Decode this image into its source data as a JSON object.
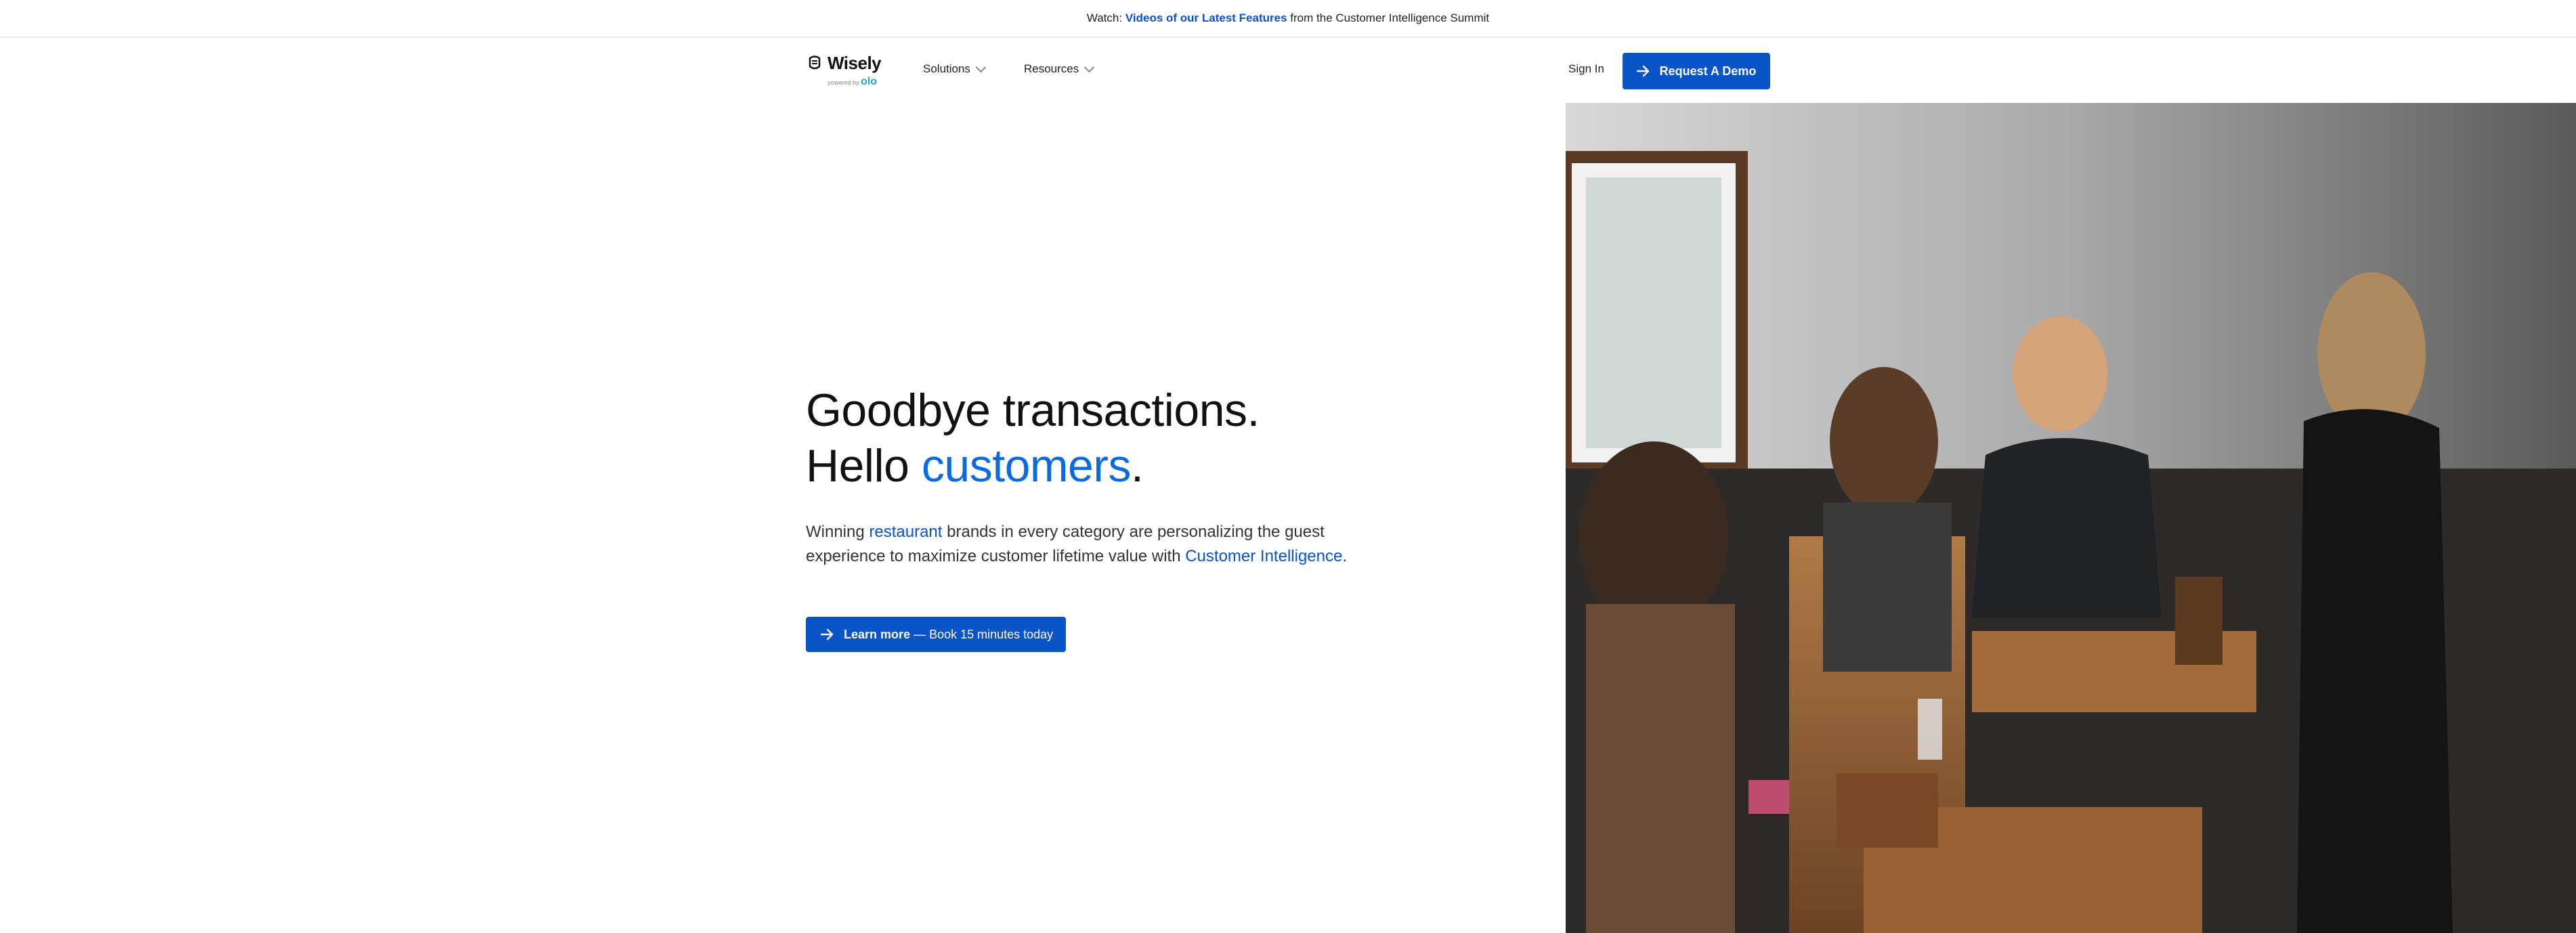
{
  "announcement": {
    "prefix": "Watch:",
    "link": "Videos of our Latest Features",
    "suffix": "from the Customer Intelligence Summit"
  },
  "logo": {
    "name": "Wisely",
    "powered_by": "powered by",
    "partner": "olo"
  },
  "nav": {
    "solutions": "Solutions",
    "resources": "Resources",
    "sign_in": "Sign In",
    "demo_button": "Request A Demo"
  },
  "hero": {
    "headline_line1": "Goodbye transactions.",
    "headline_line2_prefix": "Hello",
    "headline_line2_accent": "customers",
    "headline_line2_suffix": ".",
    "sub_1": "Winning",
    "sub_link_1": "restaurant",
    "sub_2": "brands in every category are personalizing the guest experience to maximize customer lifetime value with",
    "sub_link_2": "Customer Intelligence",
    "sub_3": ".",
    "cta_bold": "Learn more",
    "cta_rest": "— Book 15 minutes today"
  },
  "colors": {
    "brand": "#0a53c9",
    "accent": "#0a6adf"
  },
  "icons": [
    "arrow-right-icon",
    "chevron-down-icon",
    "logo-mark-icon"
  ]
}
